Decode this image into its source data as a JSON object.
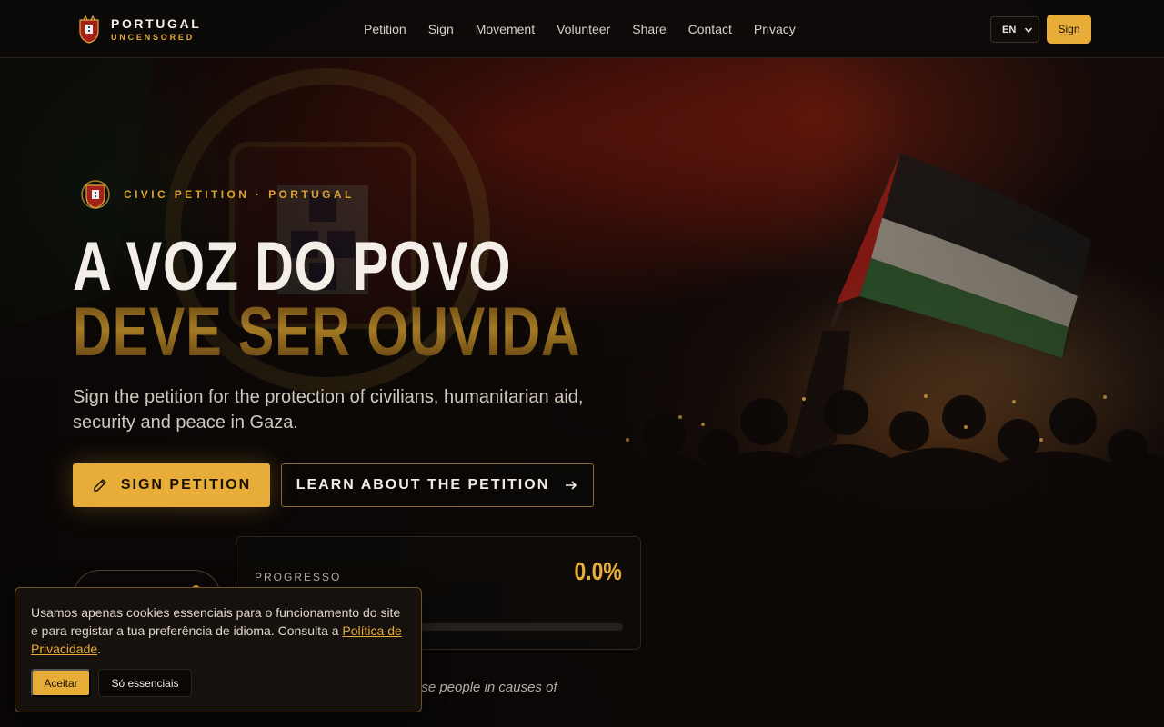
{
  "brand": {
    "line1": "PORTUGAL",
    "line2": "UNCENSORED"
  },
  "nav": {
    "items": [
      {
        "label": "Petition"
      },
      {
        "label": "Sign"
      },
      {
        "label": "Movement"
      },
      {
        "label": "Volunteer"
      },
      {
        "label": "Share"
      },
      {
        "label": "Contact"
      },
      {
        "label": "Privacy"
      }
    ]
  },
  "header": {
    "language": "EN",
    "sign_label": "Sign"
  },
  "hero": {
    "eyebrow": "CIVIC PETITION · PORTUGAL",
    "headline_line1": "A VOZ DO POVO",
    "headline_line2": "DEVE SER OUVIDA",
    "subtitle": "Sign the petition for the protection of civilians, humanitarian aid, security and peace in Gaza.",
    "primary_button": "SIGN PETITION",
    "secondary_button": "LEARN ABOUT THE PETITION"
  },
  "stats": {
    "progress_label": "PROGRESSO",
    "progress_value": "0.0%",
    "progress_fraction": 0.0
  },
  "quote": {
    "visible_fragment": "ese people in causes of"
  },
  "cookie": {
    "text": "Usamos apenas cookies essenciais para o funcionamento do site e para registar a tua preferência de idioma. Consulta a ",
    "link": "Política de Privacidade",
    "suffix": ".",
    "accept": "Aceitar",
    "essential": "Só essenciais"
  },
  "colors": {
    "accent": "#e8ad38",
    "background": "#0b0908",
    "text": "#e9e4dc"
  },
  "icons": {
    "brand": "crest-icon",
    "eyebrow": "crest-icon",
    "primary_button": "pencil-icon",
    "secondary_button": "arrow-right-icon",
    "language": "chevron-down-icon"
  }
}
